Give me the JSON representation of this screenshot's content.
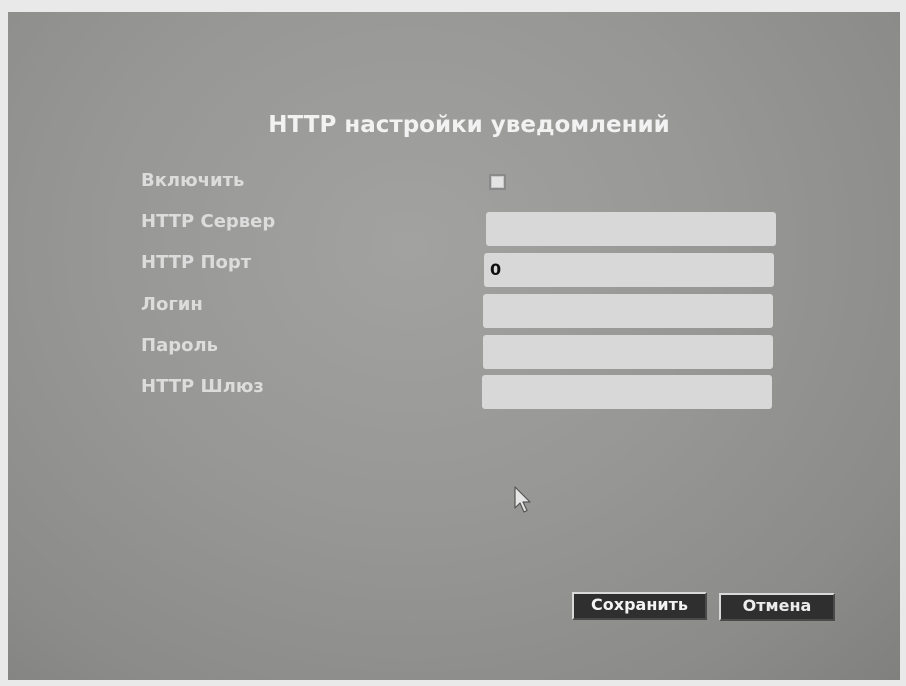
{
  "dialog": {
    "title": "HTTP настройки уведомлений"
  },
  "form": {
    "enable": {
      "label": "Включить",
      "checked": false
    },
    "server": {
      "label": "HTTP Сервер",
      "value": ""
    },
    "port": {
      "label": "HTTP Порт",
      "value": "0"
    },
    "login": {
      "label": "Логин",
      "value": ""
    },
    "password": {
      "label": "Пароль",
      "value": ""
    },
    "gateway": {
      "label": "HTTP Шлюз",
      "value": ""
    }
  },
  "buttons": {
    "save_label": "Сохранить",
    "cancel_label": "Отмена"
  },
  "icons": {
    "cursor": "mouse-pointer-icon"
  },
  "colors": {
    "background": "#979795",
    "text": "#dcdcdc",
    "field": "#d8d8d8",
    "button": "#2f2f2f"
  }
}
